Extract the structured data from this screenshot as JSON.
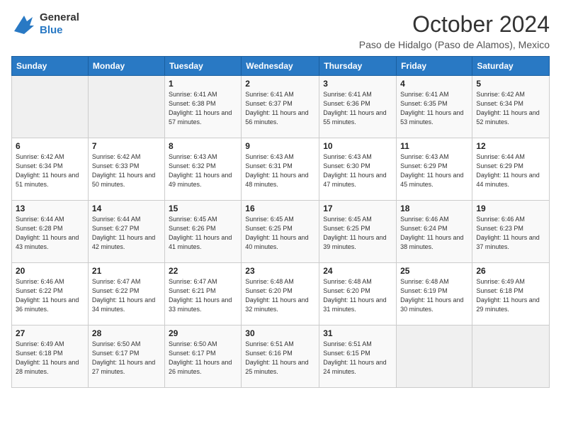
{
  "header": {
    "logo_line1": "General",
    "logo_line2": "Blue",
    "month": "October 2024",
    "location": "Paso de Hidalgo (Paso de Alamos), Mexico"
  },
  "weekdays": [
    "Sunday",
    "Monday",
    "Tuesday",
    "Wednesday",
    "Thursday",
    "Friday",
    "Saturday"
  ],
  "weeks": [
    [
      {
        "day": null
      },
      {
        "day": null
      },
      {
        "day": "1",
        "sunrise": "6:41 AM",
        "sunset": "6:38 PM",
        "daylight": "11 hours and 57 minutes."
      },
      {
        "day": "2",
        "sunrise": "6:41 AM",
        "sunset": "6:37 PM",
        "daylight": "11 hours and 56 minutes."
      },
      {
        "day": "3",
        "sunrise": "6:41 AM",
        "sunset": "6:36 PM",
        "daylight": "11 hours and 55 minutes."
      },
      {
        "day": "4",
        "sunrise": "6:41 AM",
        "sunset": "6:35 PM",
        "daylight": "11 hours and 53 minutes."
      },
      {
        "day": "5",
        "sunrise": "6:42 AM",
        "sunset": "6:34 PM",
        "daylight": "11 hours and 52 minutes."
      }
    ],
    [
      {
        "day": "6",
        "sunrise": "6:42 AM",
        "sunset": "6:34 PM",
        "daylight": "11 hours and 51 minutes."
      },
      {
        "day": "7",
        "sunrise": "6:42 AM",
        "sunset": "6:33 PM",
        "daylight": "11 hours and 50 minutes."
      },
      {
        "day": "8",
        "sunrise": "6:43 AM",
        "sunset": "6:32 PM",
        "daylight": "11 hours and 49 minutes."
      },
      {
        "day": "9",
        "sunrise": "6:43 AM",
        "sunset": "6:31 PM",
        "daylight": "11 hours and 48 minutes."
      },
      {
        "day": "10",
        "sunrise": "6:43 AM",
        "sunset": "6:30 PM",
        "daylight": "11 hours and 47 minutes."
      },
      {
        "day": "11",
        "sunrise": "6:43 AM",
        "sunset": "6:29 PM",
        "daylight": "11 hours and 45 minutes."
      },
      {
        "day": "12",
        "sunrise": "6:44 AM",
        "sunset": "6:29 PM",
        "daylight": "11 hours and 44 minutes."
      }
    ],
    [
      {
        "day": "13",
        "sunrise": "6:44 AM",
        "sunset": "6:28 PM",
        "daylight": "11 hours and 43 minutes."
      },
      {
        "day": "14",
        "sunrise": "6:44 AM",
        "sunset": "6:27 PM",
        "daylight": "11 hours and 42 minutes."
      },
      {
        "day": "15",
        "sunrise": "6:45 AM",
        "sunset": "6:26 PM",
        "daylight": "11 hours and 41 minutes."
      },
      {
        "day": "16",
        "sunrise": "6:45 AM",
        "sunset": "6:25 PM",
        "daylight": "11 hours and 40 minutes."
      },
      {
        "day": "17",
        "sunrise": "6:45 AM",
        "sunset": "6:25 PM",
        "daylight": "11 hours and 39 minutes."
      },
      {
        "day": "18",
        "sunrise": "6:46 AM",
        "sunset": "6:24 PM",
        "daylight": "11 hours and 38 minutes."
      },
      {
        "day": "19",
        "sunrise": "6:46 AM",
        "sunset": "6:23 PM",
        "daylight": "11 hours and 37 minutes."
      }
    ],
    [
      {
        "day": "20",
        "sunrise": "6:46 AM",
        "sunset": "6:22 PM",
        "daylight": "11 hours and 36 minutes."
      },
      {
        "day": "21",
        "sunrise": "6:47 AM",
        "sunset": "6:22 PM",
        "daylight": "11 hours and 34 minutes."
      },
      {
        "day": "22",
        "sunrise": "6:47 AM",
        "sunset": "6:21 PM",
        "daylight": "11 hours and 33 minutes."
      },
      {
        "day": "23",
        "sunrise": "6:48 AM",
        "sunset": "6:20 PM",
        "daylight": "11 hours and 32 minutes."
      },
      {
        "day": "24",
        "sunrise": "6:48 AM",
        "sunset": "6:20 PM",
        "daylight": "11 hours and 31 minutes."
      },
      {
        "day": "25",
        "sunrise": "6:48 AM",
        "sunset": "6:19 PM",
        "daylight": "11 hours and 30 minutes."
      },
      {
        "day": "26",
        "sunrise": "6:49 AM",
        "sunset": "6:18 PM",
        "daylight": "11 hours and 29 minutes."
      }
    ],
    [
      {
        "day": "27",
        "sunrise": "6:49 AM",
        "sunset": "6:18 PM",
        "daylight": "11 hours and 28 minutes."
      },
      {
        "day": "28",
        "sunrise": "6:50 AM",
        "sunset": "6:17 PM",
        "daylight": "11 hours and 27 minutes."
      },
      {
        "day": "29",
        "sunrise": "6:50 AM",
        "sunset": "6:17 PM",
        "daylight": "11 hours and 26 minutes."
      },
      {
        "day": "30",
        "sunrise": "6:51 AM",
        "sunset": "6:16 PM",
        "daylight": "11 hours and 25 minutes."
      },
      {
        "day": "31",
        "sunrise": "6:51 AM",
        "sunset": "6:15 PM",
        "daylight": "11 hours and 24 minutes."
      },
      {
        "day": null
      },
      {
        "day": null
      }
    ]
  ]
}
